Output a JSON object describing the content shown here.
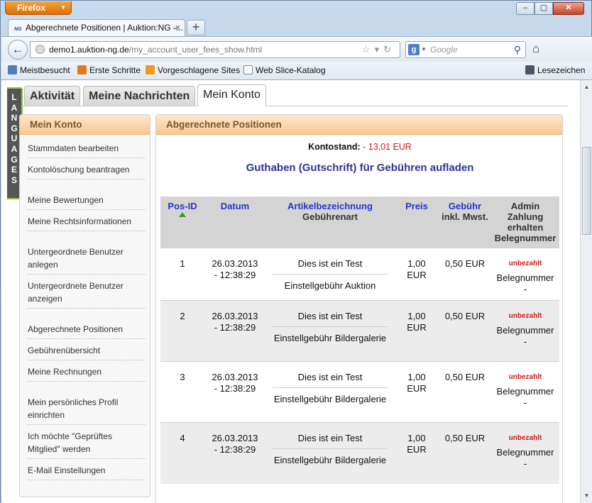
{
  "window": {
    "app_button": "Firefox",
    "minimize": "–",
    "maximize": "▢",
    "close": "✕"
  },
  "tab": {
    "favicon": "NG",
    "title": "Abgerechnete Positionen | Auktion:NG -...",
    "close": "×",
    "new_tab": "+"
  },
  "nav": {
    "url_host": "demo1.auktion-ng.de",
    "url_path": "/my_account_user_fees_show.html",
    "search_placeholder": "Google",
    "search_engine": "g"
  },
  "bookmarks": [
    {
      "label": "Meistbesucht",
      "icon_color": "#4f7fb8"
    },
    {
      "label": "Erste Schritte",
      "icon_color": "#e27a1a"
    },
    {
      "label": "Vorgeschlagene Sites",
      "icon_color": "#f39a1b"
    },
    {
      "label": "Web Slice-Katalog",
      "icon_color": "#ffffff"
    },
    {
      "label": "Lesezeichen",
      "icon_color": "#4c5663"
    }
  ],
  "languages_tab": [
    "L",
    "A",
    "N",
    "G",
    "U",
    "A",
    "G",
    "E",
    "S"
  ],
  "page_tabs": [
    "Aktivität",
    "Meine Nachrichten",
    "Mein Konto"
  ],
  "sidebar": {
    "title": "Mein Konto",
    "items": [
      "Stammdaten bearbeiten",
      "Kontolöschung beantragen",
      "Meine Bewertungen",
      "Meine Rechtsinformationen",
      "Untergeordnete Benutzer anlegen",
      "Untergeordnete Benutzer anzeigen",
      "Abgerechnete Positionen",
      "Gebührenübersicht",
      "Meine Rechnungen",
      "Mein persönliches Profil einrichten",
      "Ich möchte \"Geprüftes Mitglied\" werden",
      "E-Mail Einstellungen"
    ]
  },
  "main": {
    "title": "Abgerechnete Positionen",
    "balance_label": "Kontostand:",
    "balance_value": "- 13,01 EUR",
    "topup_link": "Guthaben (Gutschrift) für Gebühren aufladen",
    "columns": {
      "pos": "Pos-ID",
      "datum": "Datum",
      "artikel": "Artikelbezeichnung",
      "art": "Gebührenart",
      "preis": "Preis",
      "gebuehr": "Gebühr",
      "gebuehr_sub": "inkl. Mwst.",
      "admin": "Admin Zahlung erhalten Belegnummer"
    },
    "rows": [
      {
        "id": "1",
        "date": "26.03.2013",
        "time": "- 12:38:29",
        "item": "Dies ist ein Test",
        "type": "Einstellgebühr Auktion",
        "price": "1,00",
        "price_cur": "EUR",
        "fee": "0,50 EUR",
        "status": "unbezahlt",
        "beleg": "Belegnummer",
        "beleg_val": "-"
      },
      {
        "id": "2",
        "date": "26.03.2013",
        "time": "- 12:38:29",
        "item": "Dies ist ein Test",
        "type": "Einstellgebühr Bildergalerie",
        "price": "1,00",
        "price_cur": "EUR",
        "fee": "0,50 EUR",
        "status": "unbezahlt",
        "beleg": "Belegnummer",
        "beleg_val": "-"
      },
      {
        "id": "3",
        "date": "26.03.2013",
        "time": "- 12:38:29",
        "item": "Dies ist ein Test",
        "type": "Einstellgebühr Bildergalerie",
        "price": "1,00",
        "price_cur": "EUR",
        "fee": "0,50 EUR",
        "status": "unbezahlt",
        "beleg": "Belegnummer",
        "beleg_val": "-"
      },
      {
        "id": "4",
        "date": "26.03.2013",
        "time": "- 12:38:29",
        "item": "Dies ist ein Test",
        "type": "Einstellgebühr Bildergalerie",
        "price": "1,00",
        "price_cur": "EUR",
        "fee": "0,50 EUR",
        "status": "unbezahlt",
        "beleg": "Belegnummer",
        "beleg_val": "-"
      }
    ]
  }
}
